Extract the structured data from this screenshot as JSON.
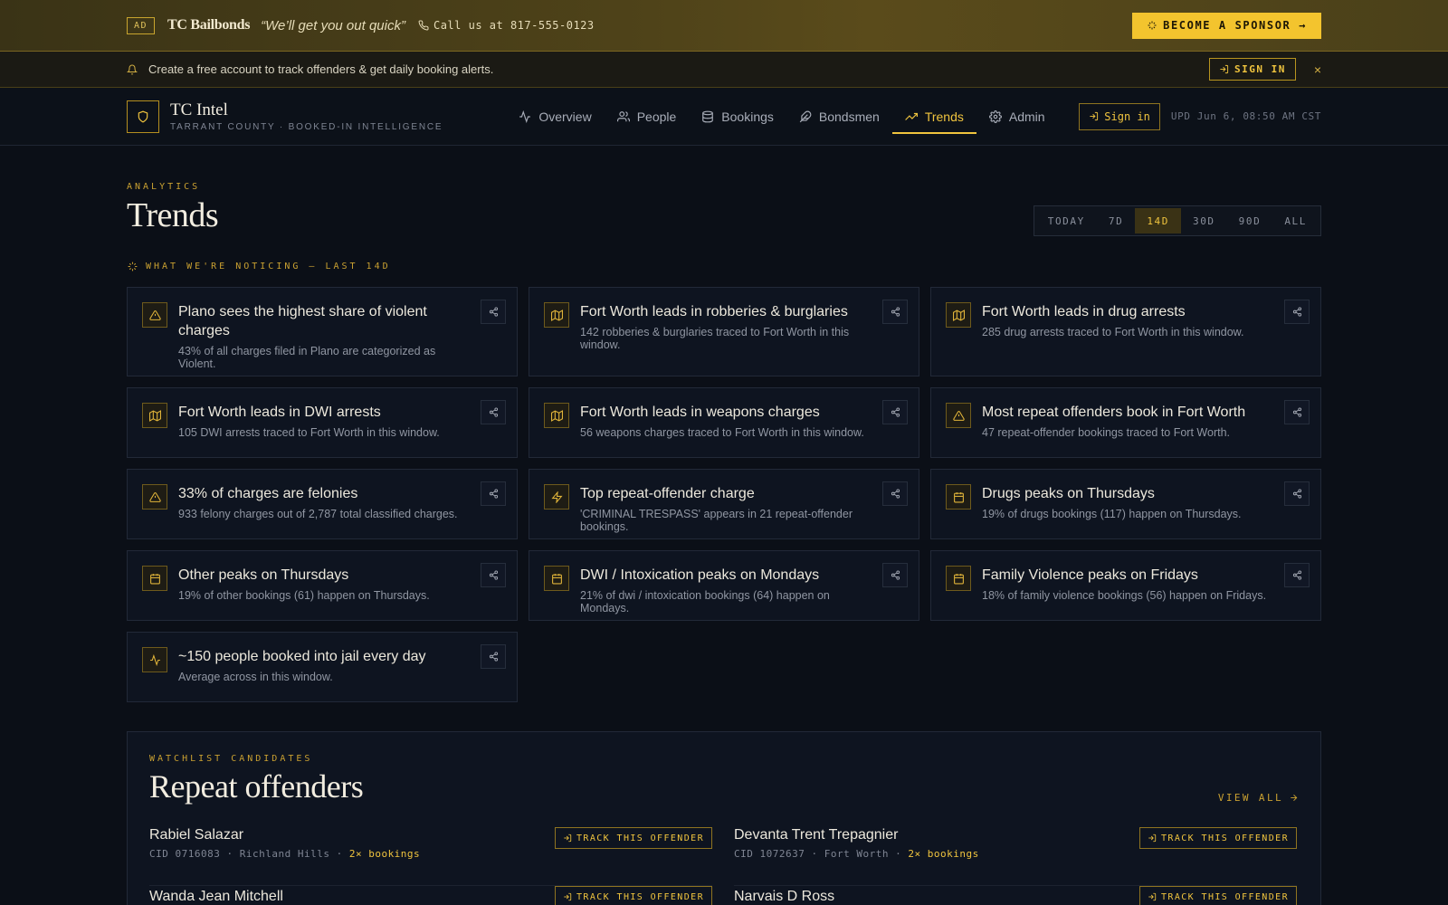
{
  "ad": {
    "tag": "AD",
    "brand": "TC Bailbonds",
    "tagline": "“We’ll get you out quick”",
    "phone": "Call us at 817-555-0123",
    "sponsor_label": "BECOME A SPONSOR →"
  },
  "alert": {
    "text": "Create a free account to track offenders & get daily booking alerts.",
    "signin_label": "SIGN IN",
    "close_icon": "×"
  },
  "nav": {
    "title": "TC Intel",
    "subtitle": "TARRANT COUNTY · BOOKED-IN INTELLIGENCE",
    "links": [
      {
        "label": "Overview",
        "icon": "activity-icon"
      },
      {
        "label": "People",
        "icon": "people-icon"
      },
      {
        "label": "Bookings",
        "icon": "database-icon"
      },
      {
        "label": "Bondsmen",
        "icon": "feather-icon"
      },
      {
        "label": "Trends",
        "icon": "trend-icon",
        "active": true
      },
      {
        "label": "Admin",
        "icon": "gear-icon"
      }
    ],
    "signin_label": "Sign in",
    "updated": "UPD Jun 6, 08:50 AM CST"
  },
  "main": {
    "eyebrow": "ANALYTICS",
    "title": "Trends",
    "ranges": [
      "TODAY",
      "7D",
      "14D",
      "30D",
      "90D",
      "ALL"
    ],
    "active_range": "14D",
    "noticing": "WHAT WE'RE NOTICING — LAST 14D"
  },
  "insights": [
    {
      "icon": "warning-icon",
      "title": "Plano sees the highest share of violent charges",
      "desc": "43% of all charges filed in Plano are categorized as Violent."
    },
    {
      "icon": "map-icon",
      "title": "Fort Worth leads in robberies & burglaries",
      "desc": "142 robberies & burglaries traced to Fort Worth in this window."
    },
    {
      "icon": "map-icon",
      "title": "Fort Worth leads in drug arrests",
      "desc": "285 drug arrests traced to Fort Worth in this window."
    },
    {
      "icon": "map-icon",
      "title": "Fort Worth leads in DWI arrests",
      "desc": "105 DWI arrests traced to Fort Worth in this window."
    },
    {
      "icon": "map-icon",
      "title": "Fort Worth leads in weapons charges",
      "desc": "56 weapons charges traced to Fort Worth in this window."
    },
    {
      "icon": "warning-icon",
      "title": "Most repeat offenders book in Fort Worth",
      "desc": "47 repeat-offender bookings traced to Fort Worth."
    },
    {
      "icon": "warning-icon",
      "title": "33% of charges are felonies",
      "desc": "933 felony charges out of 2,787 total classified charges."
    },
    {
      "icon": "bolt-icon",
      "title": "Top repeat-offender charge",
      "desc": "'CRIMINAL TRESPASS' appears in 21 repeat-offender bookings."
    },
    {
      "icon": "calendar-icon",
      "title": "Drugs peaks on Thursdays",
      "desc": "19% of drugs bookings (117) happen on Thursdays."
    },
    {
      "icon": "calendar-icon",
      "title": "Other peaks on Thursdays",
      "desc": "19% of other bookings (61) happen on Thursdays."
    },
    {
      "icon": "calendar-icon",
      "title": "DWI / Intoxication peaks on Mondays",
      "desc": "21% of dwi / intoxication bookings (64) happen on Mondays."
    },
    {
      "icon": "calendar-icon",
      "title": "Family Violence peaks on Fridays",
      "desc": "18% of family violence bookings (56) happen on Fridays."
    },
    {
      "icon": "pulse-icon",
      "title": "~150 people booked into jail every day",
      "desc": "Average across in this window."
    }
  ],
  "offenders": {
    "eyebrow": "WATCHLIST CANDIDATES",
    "title": "Repeat offenders",
    "view_all": "VIEW ALL",
    "track_label": "TRACK THIS OFFENDER",
    "rows": [
      {
        "name": "Rabiel Salazar",
        "cid": "CID 0716083",
        "city": "Richland Hills",
        "bookings": "2× bookings"
      },
      {
        "name": "Devanta Trent Trepagnier",
        "cid": "CID 1072637",
        "city": "Fort Worth",
        "bookings": "2× bookings"
      },
      {
        "name": "Wanda Jean Mitchell",
        "cid": "",
        "city": "",
        "bookings": ""
      },
      {
        "name": "Narvais D Ross",
        "cid": "",
        "city": "",
        "bookings": ""
      }
    ]
  },
  "colors": {
    "accent": "#f0c43e",
    "background": "#0b0f17",
    "card": "#0e1420",
    "ad_bar": "#4f4319"
  }
}
